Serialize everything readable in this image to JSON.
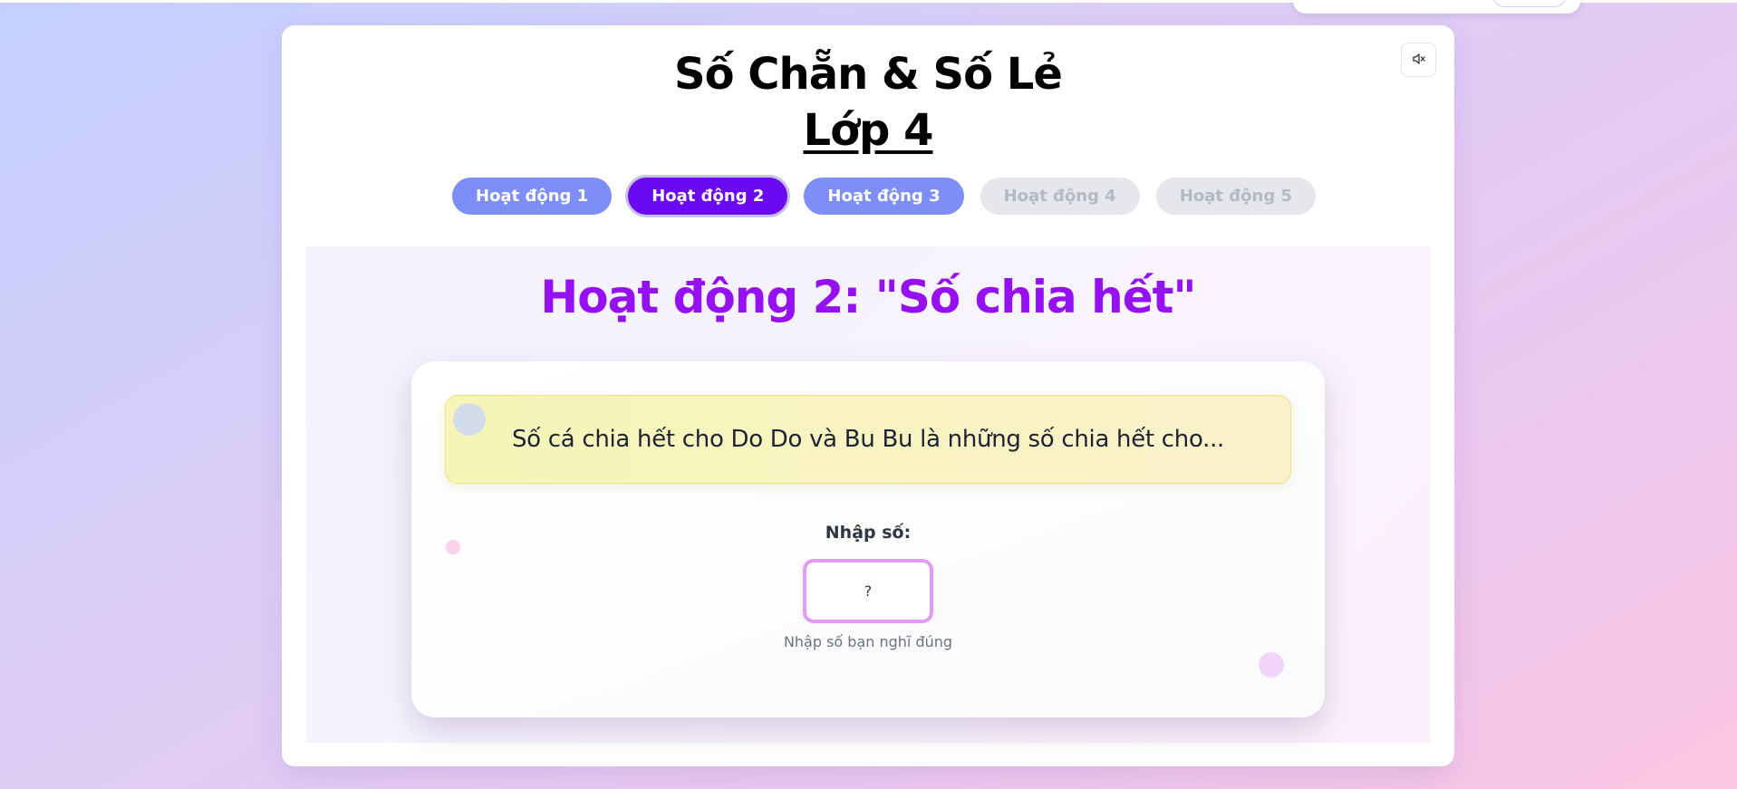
{
  "header": {
    "title_line1": "Số Chẵn & Số Lẻ",
    "title_line2": "Lớp 4",
    "mute_icon": "speaker-muted-icon"
  },
  "tabs": [
    {
      "label": "Hoạt động 1",
      "state": "available"
    },
    {
      "label": "Hoạt động 2",
      "state": "active"
    },
    {
      "label": "Hoạt động 3",
      "state": "available"
    },
    {
      "label": "Hoạt động 4",
      "state": "locked"
    },
    {
      "label": "Hoạt động 5",
      "state": "locked"
    }
  ],
  "activity": {
    "title": "Hoạt động 2: \"Số chia hết\"",
    "question": "Số cá chia hết cho Do Do và Bu Bu là những số chia hết cho...",
    "input_label": "Nhập số:",
    "input_placeholder": "?",
    "input_value": "",
    "input_hint": "Nhập số bạn nghĩ đúng"
  },
  "colors": {
    "active_tab": "#6b0af0",
    "available_tab": "#7d8ef9",
    "locked_tab": "#e6e7ec",
    "activity_title": "#9510f2",
    "input_border": "#e19bf5"
  }
}
